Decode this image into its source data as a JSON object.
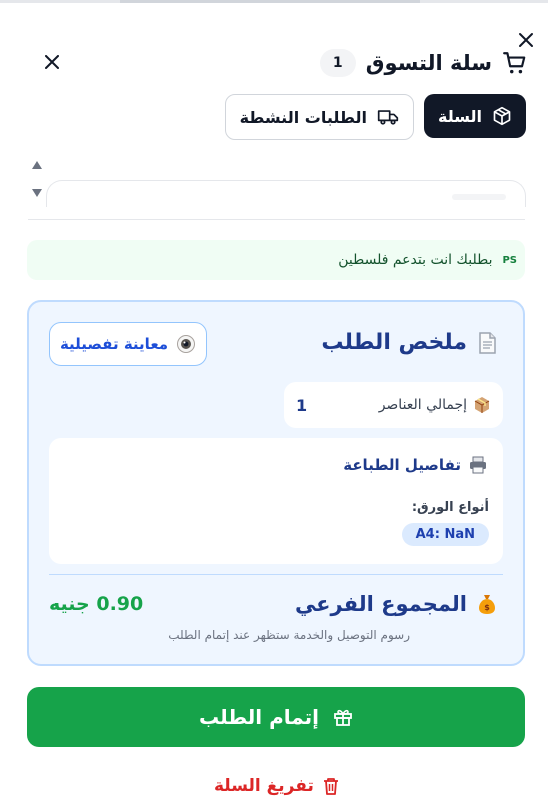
{
  "header": {
    "title": "سلة التسوق",
    "count": "1"
  },
  "tabs": [
    {
      "label": "السلة",
      "icon": "package-icon",
      "active": true
    },
    {
      "label": "الطلبات النشطة",
      "icon": "truck-icon",
      "active": false
    }
  ],
  "banner": {
    "code": "PS",
    "text": "بطلبك انت بتدعم فلسطين"
  },
  "summary": {
    "title": "ملخص الطلب",
    "preview_label": "معاينة تفصيلية",
    "items_label": "إجمالي العناصر",
    "items_value": "1",
    "print_title": "تفاصيل الطباعة",
    "paper_label": "أنواع الورق:",
    "paper_value": "A4: NaN",
    "subtotal_label": "المجموع الفرعي",
    "subtotal_value": "0.90 جنيه",
    "fee_note": "رسوم التوصيل والخدمة ستظهر عند إتمام الطلب"
  },
  "actions": {
    "checkout_label": "إتمام الطلب",
    "clear_label": "تفريغ السلة"
  },
  "colors": {
    "primary_dark": "#111827",
    "accent_blue": "#1e3a8a",
    "success_green": "#16a34a",
    "danger_red": "#dc2626"
  }
}
